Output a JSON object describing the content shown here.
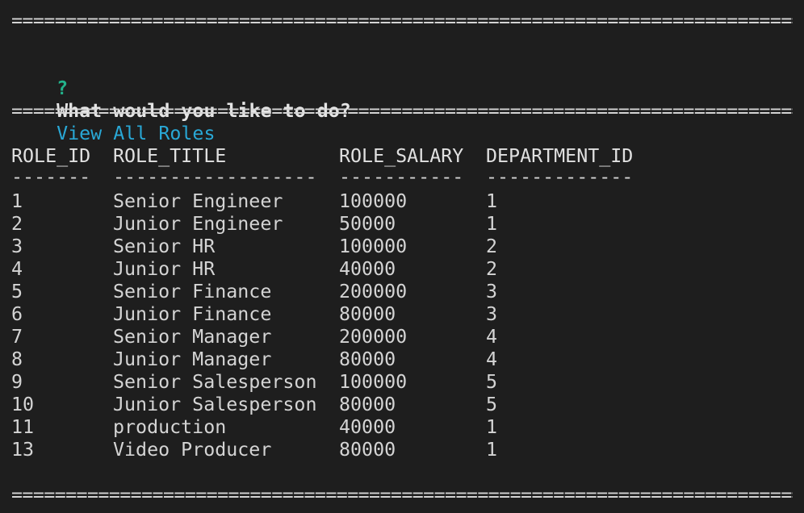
{
  "separator": "=============================================================================================================",
  "prompt": {
    "mark": "?",
    "question": "What would you like to do?",
    "answer": "View All Roles"
  },
  "table": {
    "headers": [
      "ROLE_ID",
      "ROLE_TITLE",
      "ROLE_SALARY",
      "DEPARTMENT_ID"
    ],
    "underlines": [
      "-------",
      "------------------",
      "-----------",
      "-------------"
    ],
    "rows": [
      [
        "1",
        "Senior Engineer",
        "100000",
        "1"
      ],
      [
        "2",
        "Junior Engineer",
        "50000",
        "1"
      ],
      [
        "3",
        "Senior HR",
        "100000",
        "2"
      ],
      [
        "4",
        "Junior HR",
        "40000",
        "2"
      ],
      [
        "5",
        "Senior Finance",
        "200000",
        "3"
      ],
      [
        "6",
        "Junior Finance",
        "80000",
        "3"
      ],
      [
        "7",
        "Senior Manager",
        "200000",
        "4"
      ],
      [
        "8",
        "Junior Manager",
        "80000",
        "4"
      ],
      [
        "9",
        "Senior Salesperson",
        "100000",
        "5"
      ],
      [
        "10",
        "Junior Salesperson",
        "80000",
        "5"
      ],
      [
        "11",
        "production",
        "40000",
        "1"
      ],
      [
        "13",
        "Video Producer",
        "80000",
        "1"
      ]
    ]
  },
  "colors": {
    "background": "#1e1e1e",
    "text": "#d4d4d4",
    "prompt_mark": "#23b28b",
    "answer": "#29a8d6"
  }
}
